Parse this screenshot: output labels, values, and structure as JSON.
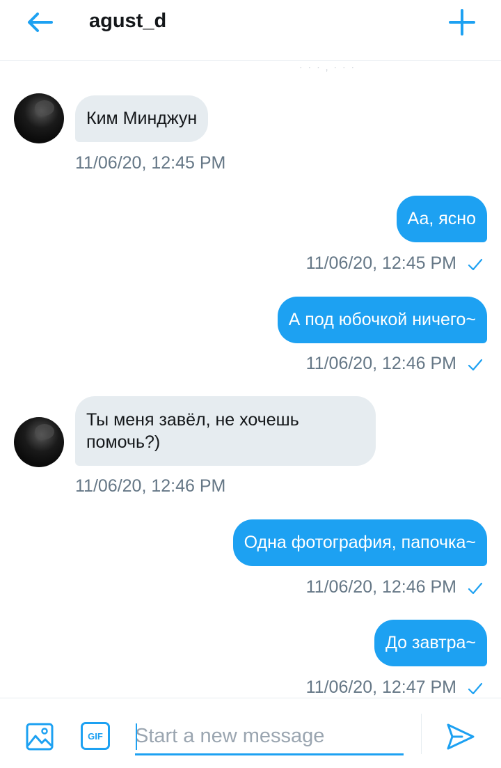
{
  "header": {
    "title": "agust_d"
  },
  "messages": {
    "faded_top": "· · · , · ·   ·",
    "items": [
      {
        "direction": "in",
        "text": "Ким Минджун",
        "time": "11/06/20, 12:45 PM"
      },
      {
        "direction": "out",
        "text": "Аа, ясно",
        "time": "11/06/20, 12:45 PM",
        "read": true
      },
      {
        "direction": "out",
        "text": "А под юбочкой ничего~",
        "time": "11/06/20, 12:46 PM",
        "read": true
      },
      {
        "direction": "in",
        "text_line1": "Ты меня завёл, не хочешь",
        "text_line2": "помочь?)",
        "time": "11/06/20, 12:46 PM"
      },
      {
        "direction": "out",
        "text": "Одна фотография, папочка~",
        "time": "11/06/20, 12:46 PM",
        "read": true
      },
      {
        "direction": "out",
        "text": "До завтра~",
        "time": "11/06/20, 12:47 PM",
        "read": true
      }
    ]
  },
  "composer": {
    "placeholder": "Start a new message",
    "gif_label": "GIF"
  },
  "colors": {
    "accent": "#1da1f2",
    "incoming_bubble": "#e6ecf0",
    "timestamp": "#657786"
  },
  "icons": {
    "back": "arrow-left-icon",
    "new": "plus-icon",
    "image": "image-icon",
    "gif": "gif-icon",
    "send": "send-icon",
    "read": "checkmark-icon"
  }
}
